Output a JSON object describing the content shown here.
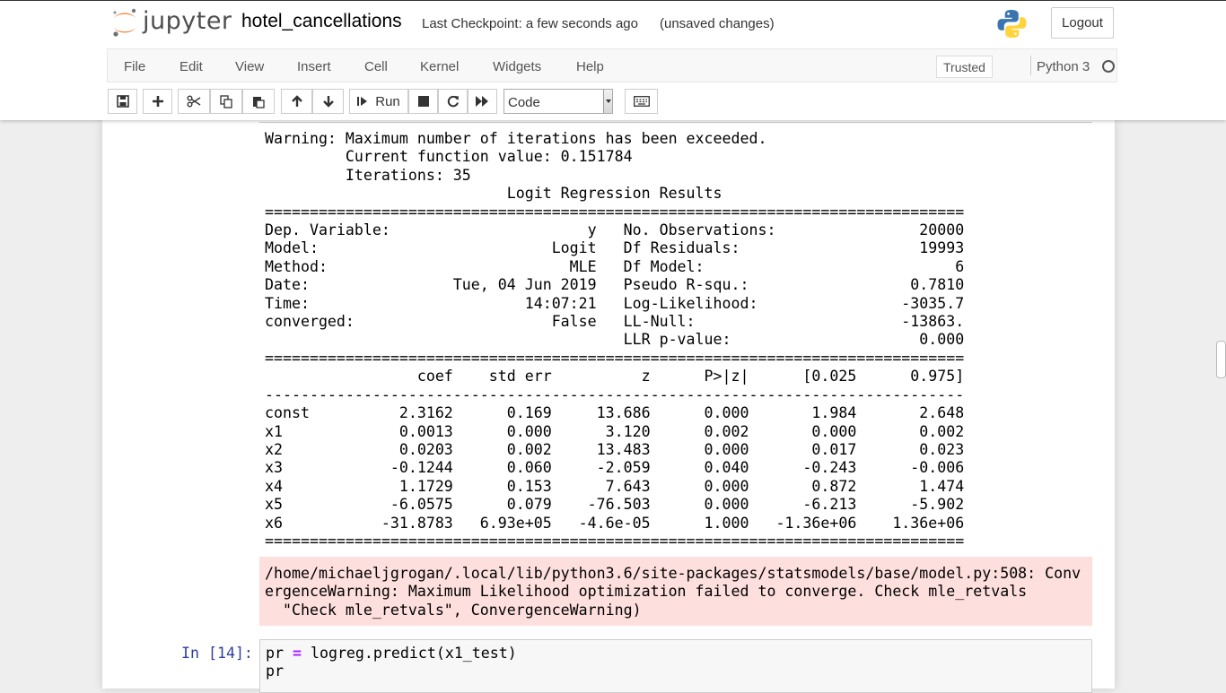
{
  "header": {
    "logo_text": "jupyter",
    "notebook_name": "hotel_cancellations",
    "checkpoint": "Last Checkpoint: a few seconds ago",
    "unsaved": "(unsaved changes)",
    "logout_label": "Logout"
  },
  "menubar": {
    "items": [
      "File",
      "Edit",
      "View",
      "Insert",
      "Cell",
      "Kernel",
      "Widgets",
      "Help"
    ],
    "trusted_label": "Trusted",
    "kernel_name": "Python 3"
  },
  "toolbar": {
    "run_label": "Run",
    "cell_type": "Code",
    "icons": [
      "save-icon",
      "plus-icon",
      "cut-icon",
      "copy-icon",
      "paste-icon",
      "arrow-up-icon",
      "arrow-down-icon",
      "step-forward-icon",
      "stop-icon",
      "restart-icon",
      "fast-forward-icon",
      "keyboard-icon"
    ]
  },
  "output": {
    "stdout": "Warning: Maximum number of iterations has been exceeded.\n         Current function value: 0.151784\n         Iterations: 35\n                           Logit Regression Results                           \n==============================================================================\nDep. Variable:                      y   No. Observations:                20000\nModel:                          Logit   Df Residuals:                    19993\nMethod:                           MLE   Df Model:                            6\nDate:                Tue, 04 Jun 2019   Pseudo R-squ.:                  0.7810\nTime:                        14:07:21   Log-Likelihood:                -3035.7\nconverged:                      False   LL-Null:                       -13863.\n                                        LLR p-value:                     0.000\n==============================================================================\n                 coef    std err          z      P>|z|      [0.025      0.975]\n------------------------------------------------------------------------------\nconst          2.3162      0.169     13.686      0.000       1.984       2.648\nx1             0.0013      0.000      3.120      0.002       0.000       0.002\nx2             0.0203      0.002     13.483      0.000       0.017       0.023\nx3            -0.1244      0.060     -2.059      0.040      -0.243      -0.006\nx4             1.1729      0.153      7.643      0.000       0.872       1.474\nx5            -6.0575      0.079    -76.503      0.000      -6.213      -5.902\nx6           -31.8783   6.93e+05   -4.6e-05      1.000   -1.36e+06    1.36e+06\n==============================================================================",
    "stderr": "/home/michaeljgrogan/.local/lib/python3.6/site-packages/statsmodels/base/model.py:508: Conv\nergenceWarning: Maximum Likelihood optimization failed to converge. Check mle_retvals\n  \"Check mle_retvals\", ConvergenceWarning)"
  },
  "cell": {
    "prompt": "In [14]:",
    "line1_var": "pr ",
    "line1_op": "=",
    "line1_rest": " logreg.predict(x1_test)",
    "line2": "pr"
  }
}
